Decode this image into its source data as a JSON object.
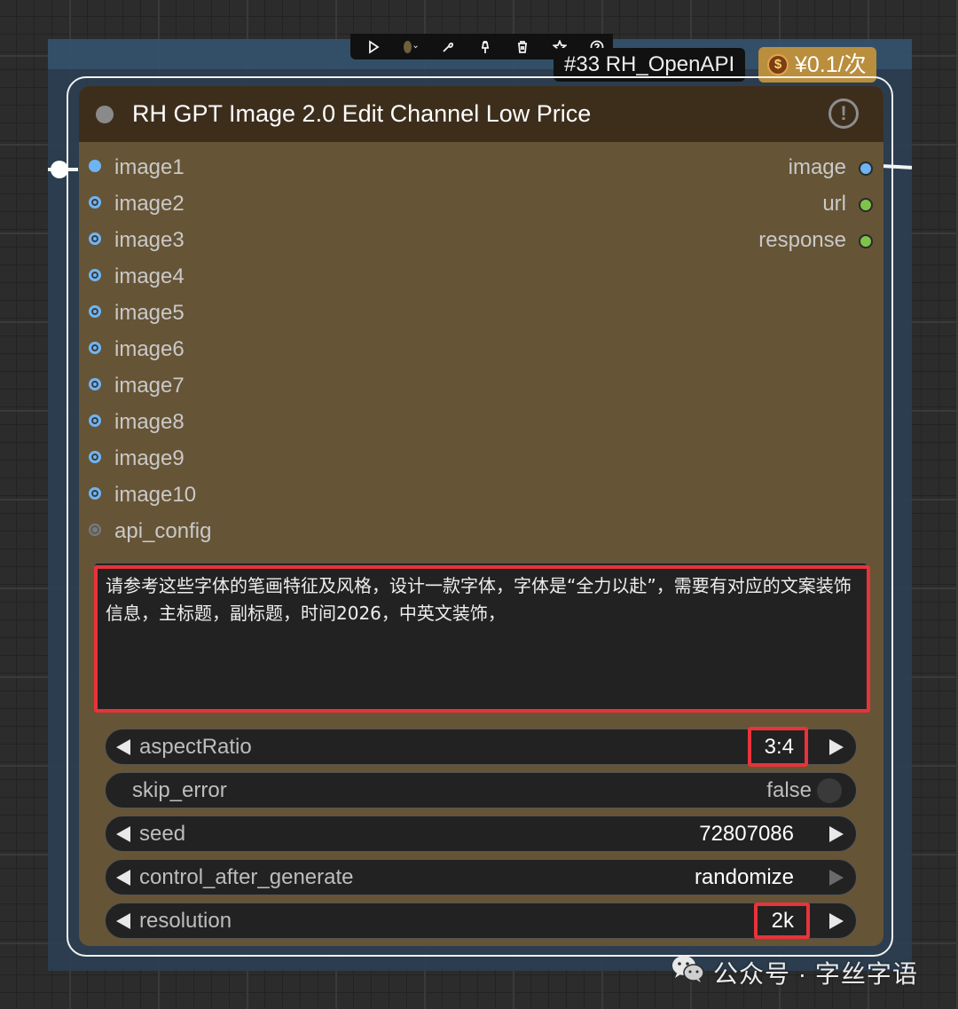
{
  "toolbar": {
    "icons": [
      "play-icon",
      "color-picker-icon",
      "bypass-icon",
      "pin-icon",
      "delete-icon",
      "favorite-icon",
      "help-icon"
    ]
  },
  "node_badges": {
    "id_label": "#33 RH_OpenAPI",
    "price_symbol": "$",
    "price_label": "¥0.1/次"
  },
  "node": {
    "title": "RH GPT Image 2.0 Edit Channel Low Price",
    "warning_symbol": "!",
    "inputs": [
      "image1",
      "image2",
      "image3",
      "image4",
      "image5",
      "image6",
      "image7",
      "image8",
      "image9",
      "image10",
      "api_config"
    ],
    "outputs": [
      "image",
      "url",
      "response"
    ],
    "prompt": "请参考这些字体的笔画特征及风格，设计一款字体，字体是“全力以赴”，需要有对应的文案装饰信息，主标题，副标题，时间2026，中英文装饰，",
    "widgets": {
      "aspectRatio": {
        "label": "aspectRatio",
        "value": "3:4"
      },
      "skip_error": {
        "label": "skip_error",
        "value": "false"
      },
      "seed": {
        "label": "seed",
        "value": "72807086"
      },
      "control_after_generate": {
        "label": "control_after_generate",
        "value": "randomize"
      },
      "resolution": {
        "label": "resolution",
        "value": "2k"
      }
    }
  },
  "watermark": {
    "text": "公众号 · 字丝字语"
  },
  "colors": {
    "node_body": "#665436",
    "node_header": "#3d2e1c",
    "highlight": "#e8333b",
    "price_badge": "#b98e3d",
    "input_dot": "#6fb4f2",
    "output_green": "#7fc44a"
  }
}
